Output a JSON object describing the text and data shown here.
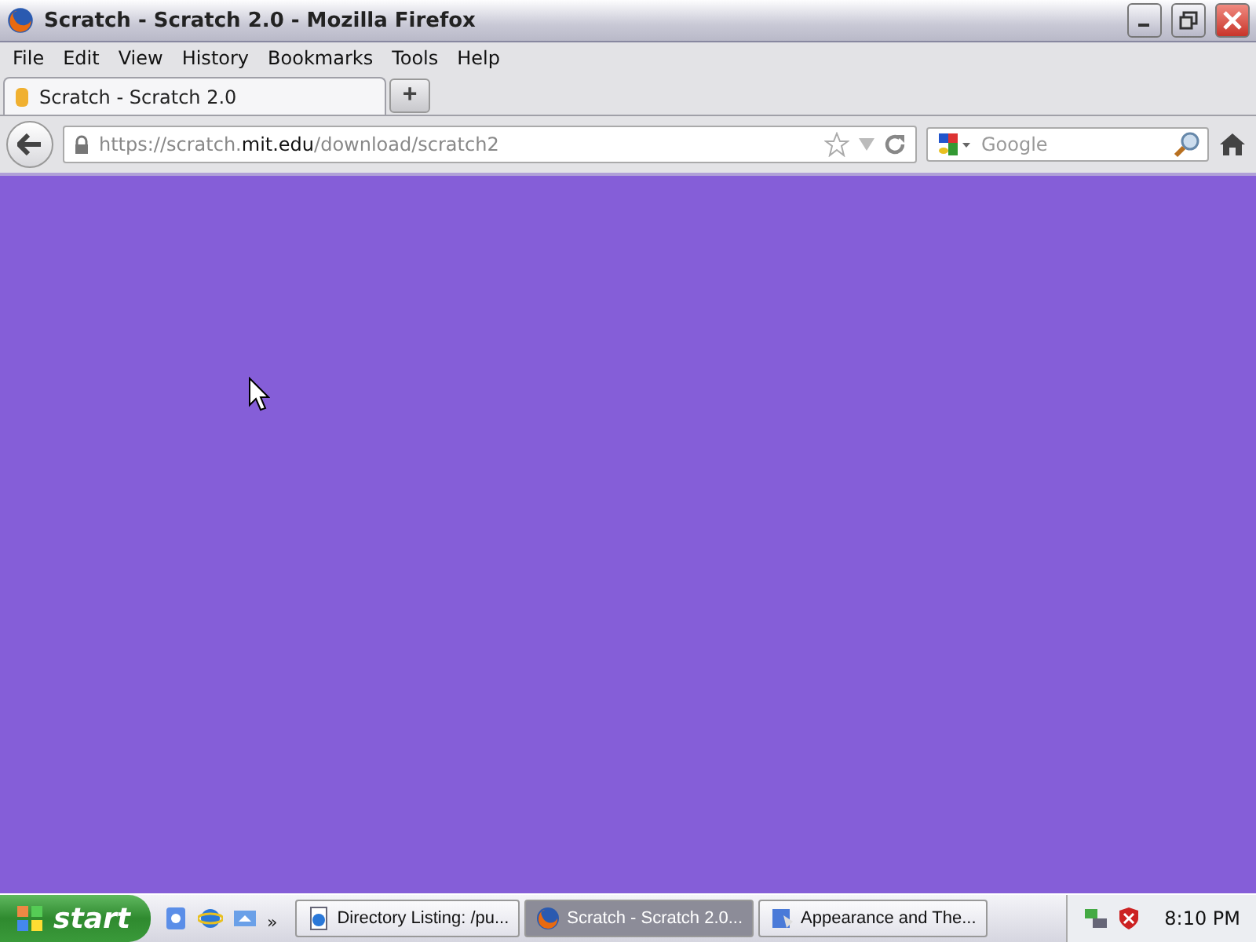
{
  "window": {
    "title": "Scratch - Scratch 2.0 - Mozilla Firefox"
  },
  "menu": [
    "File",
    "Edit",
    "View",
    "History",
    "Bookmarks",
    "Tools",
    "Help"
  ],
  "tabs": [
    {
      "label": "Scratch - Scratch 2.0",
      "selected": true
    }
  ],
  "new_tab": "+",
  "address": {
    "scheme": "https://scratch.",
    "domain": "mit.edu",
    "path": "/download/scratch2"
  },
  "search": {
    "placeholder": "Google"
  },
  "taskbar": {
    "start": "start",
    "chevron": "»",
    "tasks": [
      {
        "label": "Directory Listing: /pu...",
        "selected": false,
        "kind": "ie"
      },
      {
        "label": "Scratch - Scratch 2.0...",
        "selected": true,
        "kind": "firefox"
      },
      {
        "label": "Appearance and The...",
        "selected": false,
        "kind": "panel"
      }
    ],
    "clock": "8:10 PM"
  }
}
